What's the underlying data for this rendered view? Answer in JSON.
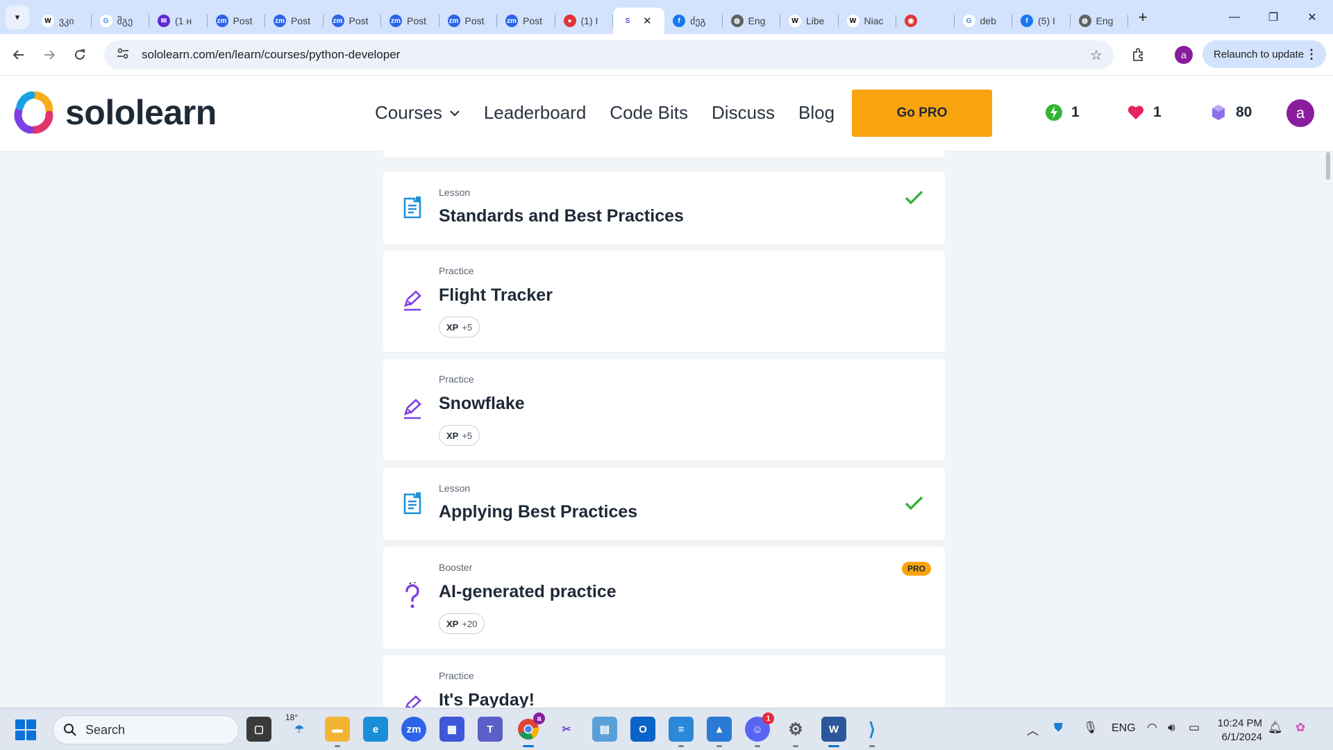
{
  "browser": {
    "tabs": [
      {
        "favicon": "W",
        "favicon_name": "wikipedia-icon",
        "title": "ვკი",
        "bg": "#ffffff",
        "fg": "#000000"
      },
      {
        "favicon": "G",
        "favicon_name": "google-icon",
        "title": "მგე",
        "bg": "#ffffff",
        "fg": "#4285f4"
      },
      {
        "favicon": "✉",
        "favicon_name": "mail-icon",
        "title": "(1 н",
        "bg": "#5f2bd3",
        "fg": "#ffffff"
      },
      {
        "favicon": "zm",
        "favicon_name": "zoom-icon",
        "title": "Post",
        "bg": "#2d63e8",
        "fg": "#ffffff"
      },
      {
        "favicon": "zm",
        "favicon_name": "zoom-icon",
        "title": "Post",
        "bg": "#2d63e8",
        "fg": "#ffffff"
      },
      {
        "favicon": "zm",
        "favicon_name": "zoom-icon",
        "title": "Post",
        "bg": "#2d63e8",
        "fg": "#ffffff"
      },
      {
        "favicon": "zm",
        "favicon_name": "zoom-icon",
        "title": "Post",
        "bg": "#2d63e8",
        "fg": "#ffffff"
      },
      {
        "favicon": "zm",
        "favicon_name": "zoom-icon",
        "title": "Post",
        "bg": "#2d63e8",
        "fg": "#ffffff"
      },
      {
        "favicon": "zm",
        "favicon_name": "zoom-icon",
        "title": "Post",
        "bg": "#2d63e8",
        "fg": "#ffffff"
      },
      {
        "favicon": "●",
        "favicon_name": "notification-icon",
        "title": "(1) I",
        "bg": "#e0353b",
        "fg": "#ffffff"
      },
      {
        "favicon": "S",
        "favicon_name": "sololearn-icon",
        "title": "",
        "bg": "#ffffff",
        "fg": "#6b3fd9",
        "active": true
      },
      {
        "favicon": "f",
        "favicon_name": "facebook-icon",
        "title": "ძეგ",
        "bg": "#1877f2",
        "fg": "#ffffff"
      },
      {
        "favicon": "◍",
        "favicon_name": "globe-icon",
        "title": "Eng",
        "bg": "#5f6368",
        "fg": "#ffffff"
      },
      {
        "favicon": "W",
        "favicon_name": "wikipedia-icon",
        "title": "Libe",
        "bg": "#ffffff",
        "fg": "#000000"
      },
      {
        "favicon": "W",
        "favicon_name": "wikipedia-icon",
        "title": "Niac",
        "bg": "#ffffff",
        "fg": "#000000"
      },
      {
        "favicon": "◉",
        "favicon_name": "record-icon",
        "title": "",
        "bg": "#e0353b",
        "fg": "#ffffff"
      },
      {
        "favicon": "G",
        "favicon_name": "google-icon",
        "title": "deb",
        "bg": "#ffffff",
        "fg": "#4285f4"
      },
      {
        "favicon": "f",
        "favicon_name": "facebook-icon",
        "title": "(5) I",
        "bg": "#1877f2",
        "fg": "#ffffff"
      },
      {
        "favicon": "◍",
        "favicon_name": "globe-icon",
        "title": "Eng",
        "bg": "#5f6368",
        "fg": "#ffffff"
      }
    ],
    "new_tab": "+",
    "url": "sololearn.com/en/learn/courses/python-developer",
    "relaunch_label": "Relaunch to update",
    "profile_initial": "a",
    "window_controls": {
      "minimize": "—",
      "restore": "❐",
      "close": "✕"
    }
  },
  "header": {
    "logo_text": "sololearn",
    "nav": {
      "courses": "Courses",
      "leaderboard": "Leaderboard",
      "code_bits": "Code Bits",
      "discuss": "Discuss",
      "blog": "Blog"
    },
    "go_pro": "Go PRO",
    "streak": "1",
    "hearts": "1",
    "gems": "80",
    "avatar_initial": "a"
  },
  "cards": [
    {
      "type": "Lesson",
      "title": "Standards and Best Practices",
      "icon": "lesson",
      "completed": true
    },
    {
      "type": "Practice",
      "title": "Flight Tracker",
      "icon": "practice",
      "xp_label": "XP",
      "xp": "+5"
    },
    {
      "type": "Practice",
      "title": "Snowflake",
      "icon": "practice",
      "xp_label": "XP",
      "xp": "+5"
    },
    {
      "type": "Lesson",
      "title": "Applying Best Practices",
      "icon": "lesson",
      "completed": true
    },
    {
      "type": "Booster",
      "title": "AI-generated practice",
      "icon": "booster",
      "xp_label": "XP",
      "xp": "+20",
      "badge": "PRO"
    },
    {
      "type": "Practice",
      "title": "It's Payday!",
      "icon": "practice"
    }
  ],
  "taskbar": {
    "search_placeholder": "Search",
    "weather_temp": "18°",
    "language": "ENG",
    "time": "10:24 PM",
    "date": "6/1/2024",
    "discord_badge": "1",
    "chrome_badge": "a"
  },
  "colors": {
    "accent_purple": "#6b3fd9",
    "lesson_blue": "#1e90d6",
    "check_green": "#36b336",
    "pro_orange": "#f9a40e"
  }
}
